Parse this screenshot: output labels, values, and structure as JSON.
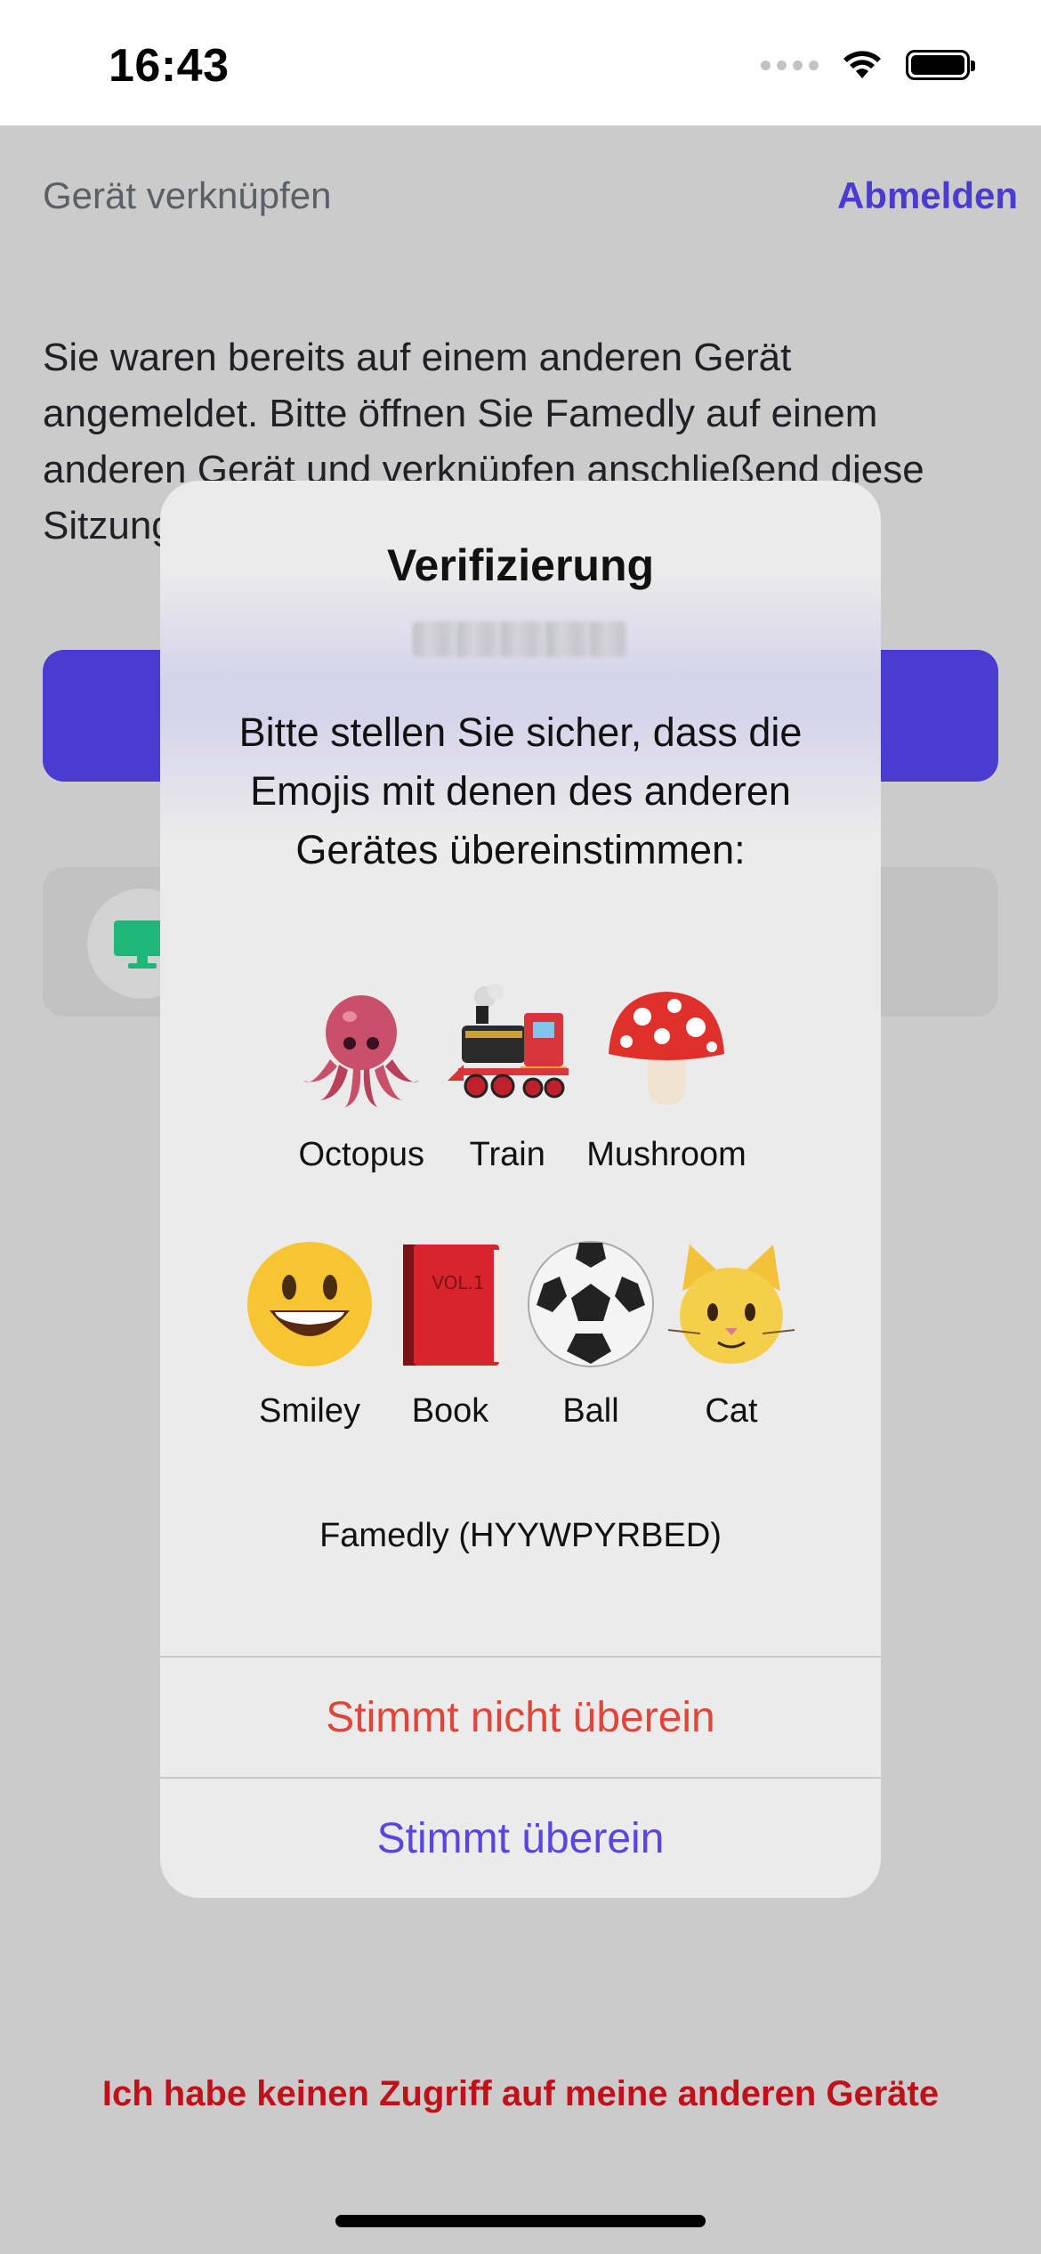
{
  "status_bar": {
    "time": "16:43"
  },
  "header": {
    "title": "Gerät verknüpfen",
    "logout_label": "Abmelden"
  },
  "main": {
    "description": "Sie waren bereits auf einem anderen Gerät angemeldet. Bitte öffnen Sie Famedly auf einem anderen Gerät und verknüpfen anschließend diese Sitzung.",
    "no_access_label": "Ich habe keinen Zugriff auf meine anderen Geräte"
  },
  "dialog": {
    "title": "Verifizierung",
    "message": "Bitte stellen Sie sicher, dass die Emojis mit denen des anderen Gerätes übereinstimmen:",
    "emojis_row1": [
      {
        "name": "octopus-icon",
        "label": "Octopus"
      },
      {
        "name": "train-icon",
        "label": "Train"
      },
      {
        "name": "mushroom-icon",
        "label": "Mushroom"
      }
    ],
    "emojis_row2": [
      {
        "name": "smiley-icon",
        "label": "Smiley"
      },
      {
        "name": "book-icon",
        "label": "Book"
      },
      {
        "name": "ball-icon",
        "label": "Ball"
      },
      {
        "name": "cat-icon",
        "label": "Cat"
      }
    ],
    "app_id": "Famedly (HYYWPYRBED)",
    "reject_label": "Stimmt nicht überein",
    "accept_label": "Stimmt überein"
  },
  "colors": {
    "accent": "#4a3cd0",
    "danger": "#c0101a",
    "reject": "#e0453a",
    "accept": "#5a46dc",
    "device_icon": "#1fb87a"
  }
}
